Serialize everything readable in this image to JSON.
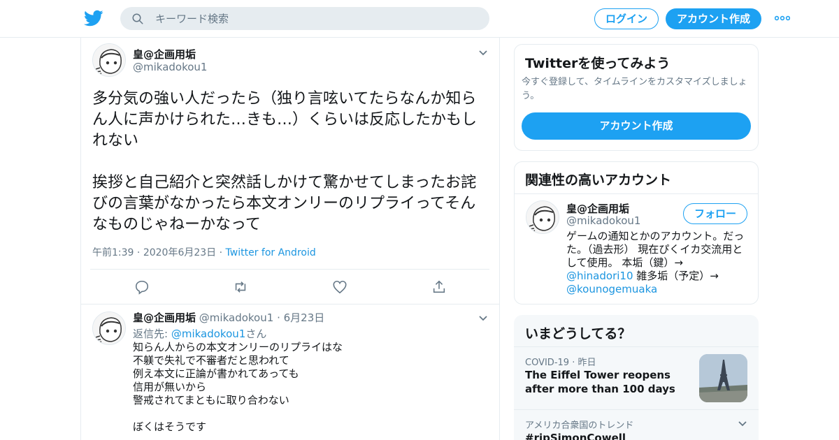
{
  "header": {
    "logo_icon": "twitter-bird-icon",
    "search_placeholder": "キーワード検索",
    "login_label": "ログイン",
    "signup_label": "アカウント作成",
    "more_icon": "more-dots-icon",
    "accent_color": "#1da1f2"
  },
  "tweet": {
    "author_name": "皇@企画用垢",
    "author_handle": "@mikadokou1",
    "text": "多分気の強い人だったら（独り言呟いてたらなんか知らん人に声かけられた…きも…）くらいは反応したかもしれない\n\n挨拶と自己紹介と突然話しかけて驚かせてしまったお詫びの言葉がなかったら本文オンリーのリプライってそんなものじゃねーかなって",
    "time": "午前1:39",
    "date": "2020年6月23日",
    "source": "Twitter for Android",
    "actions": [
      "reply-icon",
      "retweet-icon",
      "like-icon",
      "share-icon"
    ]
  },
  "reply": {
    "author_name": "皇@企画用垢",
    "author_handle": "@mikadokou1",
    "date": "6月23日",
    "reply_to_prefix": "返信先: ",
    "reply_to_handle": "@mikadokou1",
    "reply_to_suffix": "さん",
    "text": "知らん人からの本文オンリーのリプライはな\n不躾で失礼で不審者だと思われて\n例え本文に正論が書かれてあっても\n信用が無いから\n警戒されてまともに取り合わない\n\nぼくはそうです"
  },
  "signup_card": {
    "title": "Twitterを使ってみよう",
    "subtitle": "今すぐ登録して、タイムラインをカスタマイズしましょう。",
    "button": "アカウント作成"
  },
  "related_card": {
    "title": "関連性の高いアカウント",
    "name": "皇@企画用垢",
    "handle": "@mikadokou1",
    "follow_label": "フォロー",
    "bio_text": "ゲームの通知とかのアカウント。だった。（過去形） 現在ぴくイカ交流用として使用。 本垢（鍵）→ ",
    "bio_link1": "@hinadori10",
    "bio_mid": " 雑多垢（予定）→ ",
    "bio_link2": "@kounogemuaka"
  },
  "trends": {
    "title": "いまどうしてる？",
    "items": [
      {
        "category": "COVID-19",
        "time": "昨日",
        "title": "The Eiffel Tower reopens after more than 100 days"
      },
      {
        "category": "アメリカ合衆国のトレンド",
        "title": "#ripSimonCowell"
      }
    ]
  }
}
